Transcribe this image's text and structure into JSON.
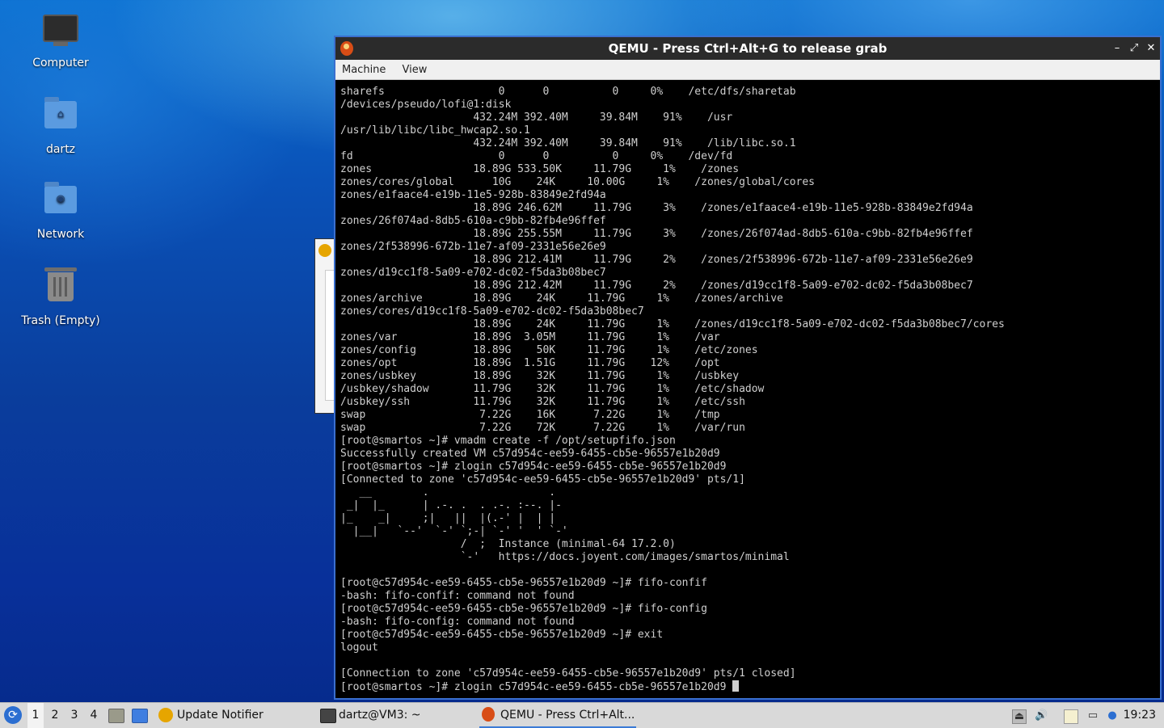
{
  "desktop": {
    "icons": [
      {
        "label": "Computer"
      },
      {
        "label": "dartz"
      },
      {
        "label": "Network"
      },
      {
        "label": "Trash (Empty)"
      }
    ]
  },
  "qemu": {
    "title": "QEMU - Press Ctrl+Alt+G to release grab",
    "menu": [
      "Machine",
      "View"
    ],
    "buttons": {
      "minimize": "–",
      "maximize": "⤢",
      "close": "✕"
    },
    "console_lines": [
      "sharefs                  0      0          0     0%    /etc/dfs/sharetab",
      "/devices/pseudo/lofi@1:disk",
      "                     432.24M 392.40M     39.84M    91%    /usr",
      "/usr/lib/libc/libc_hwcap2.so.1",
      "                     432.24M 392.40M     39.84M    91%    /lib/libc.so.1",
      "fd                       0      0          0     0%    /dev/fd",
      "zones                18.89G 533.50K     11.79G     1%    /zones",
      "zones/cores/global      10G    24K     10.00G     1%    /zones/global/cores",
      "zones/e1faace4-e19b-11e5-928b-83849e2fd94a",
      "                     18.89G 246.62M     11.79G     3%    /zones/e1faace4-e19b-11e5-928b-83849e2fd94a",
      "zones/26f074ad-8db5-610a-c9bb-82fb4e96ffef",
      "                     18.89G 255.55M     11.79G     3%    /zones/26f074ad-8db5-610a-c9bb-82fb4e96ffef",
      "zones/2f538996-672b-11e7-af09-2331e56e26e9",
      "                     18.89G 212.41M     11.79G     2%    /zones/2f538996-672b-11e7-af09-2331e56e26e9",
      "zones/d19cc1f8-5a09-e702-dc02-f5da3b08bec7",
      "                     18.89G 212.42M     11.79G     2%    /zones/d19cc1f8-5a09-e702-dc02-f5da3b08bec7",
      "zones/archive        18.89G    24K     11.79G     1%    /zones/archive",
      "zones/cores/d19cc1f8-5a09-e702-dc02-f5da3b08bec7",
      "                     18.89G    24K     11.79G     1%    /zones/d19cc1f8-5a09-e702-dc02-f5da3b08bec7/cores",
      "zones/var            18.89G  3.05M     11.79G     1%    /var",
      "zones/config         18.89G    50K     11.79G     1%    /etc/zones",
      "zones/opt            18.89G  1.51G     11.79G    12%    /opt",
      "zones/usbkey         18.89G    32K     11.79G     1%    /usbkey",
      "/usbkey/shadow       11.79G    32K     11.79G     1%    /etc/shadow",
      "/usbkey/ssh          11.79G    32K     11.79G     1%    /etc/ssh",
      "swap                  7.22G    16K      7.22G     1%    /tmp",
      "swap                  7.22G    72K      7.22G     1%    /var/run",
      "[root@smartos ~]# vmadm create -f /opt/setupfifo.json",
      "Successfully created VM c57d954c-ee59-6455-cb5e-96557e1b20d9",
      "[root@smartos ~]# zlogin c57d954c-ee59-6455-cb5e-96557e1b20d9",
      "[Connected to zone 'c57d954c-ee59-6455-cb5e-96557e1b20d9' pts/1]",
      "   __        .                   .",
      " _|  |_      | .-. .  . .-. :--. |-",
      "|_    _|     ;|   ||  |(.-' |  | |",
      "  |__|   `--'  `-' `;-| `-' '  ' `-'",
      "                   /  ;  Instance (minimal-64 17.2.0)",
      "                   `-'   https://docs.joyent.com/images/smartos/minimal",
      "",
      "[root@c57d954c-ee59-6455-cb5e-96557e1b20d9 ~]# fifo-confif",
      "-bash: fifo-confif: command not found",
      "[root@c57d954c-ee59-6455-cb5e-96557e1b20d9 ~]# fifo-config",
      "-bash: fifo-config: command not found",
      "[root@c57d954c-ee59-6455-cb5e-96557e1b20d9 ~]# exit",
      "logout",
      "",
      "[Connection to zone 'c57d954c-ee59-6455-cb5e-96557e1b20d9' pts/1 closed]"
    ],
    "prompt_line": "[root@smartos ~]# zlogin c57d954c-ee59-6455-cb5e-96557e1b20d9 "
  },
  "taskbar": {
    "workspaces": [
      "1",
      "2",
      "3",
      "4"
    ],
    "tasks": [
      {
        "label": "Update Notifier"
      },
      {
        "label": "dartz@VM3: ~"
      },
      {
        "label": "QEMU - Press Ctrl+Alt..."
      }
    ],
    "clock": "19:23"
  },
  "colors": {
    "accent": "#3b7bd6",
    "terminal_fg": "#cfcfcf",
    "terminal_bg": "#000000"
  }
}
